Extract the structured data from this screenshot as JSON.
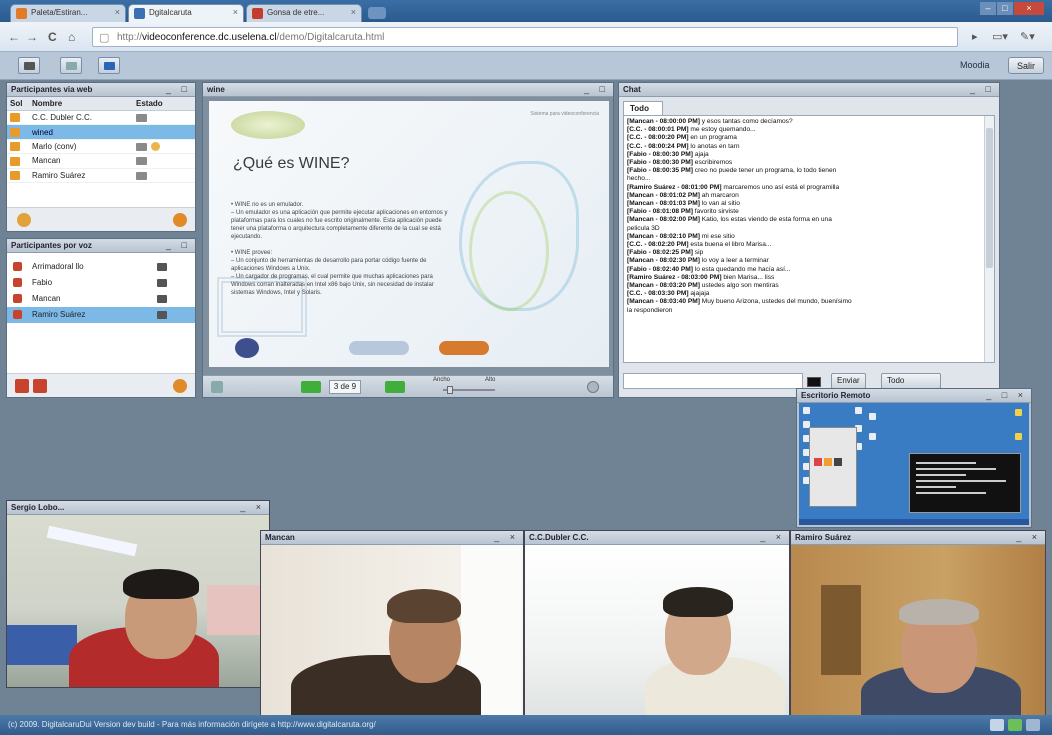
{
  "browser": {
    "tabs": [
      {
        "label": "Paleta/Estiran..."
      },
      {
        "label": "Dgitalcaruta"
      },
      {
        "label": "Gonsa de etre..."
      }
    ],
    "url_prefix": "http://",
    "url_domain": "videoconference.dc.uselena.cl",
    "url_path": "/demo/Digitalcaruta.html"
  },
  "toolbar": {
    "user_label": "Moodia",
    "exit_label": "Salir"
  },
  "participants_web": {
    "title": "Participantes via web",
    "columns": [
      "Sol",
      "Nombre",
      "Estado"
    ],
    "rows": [
      {
        "name": "C.C. Dubler C.C.",
        "cam": true,
        "hand": false,
        "selected": false
      },
      {
        "name": "wined",
        "cam": false,
        "hand": false,
        "selected": true
      },
      {
        "name": "Marlo (conv)",
        "cam": true,
        "hand": true,
        "selected": false
      },
      {
        "name": "Mancan",
        "cam": true,
        "hand": false,
        "selected": false
      },
      {
        "name": "Ramiro Suárez",
        "cam": true,
        "hand": false,
        "selected": false
      }
    ]
  },
  "participants_voice": {
    "title": "Participantes por voz",
    "rows": [
      {
        "name": "Arrimadoral llo",
        "selected": false
      },
      {
        "name": "Fabio",
        "selected": false
      },
      {
        "name": "Mancan",
        "selected": false
      },
      {
        "name": "Ramiro Suárez",
        "selected": true
      }
    ]
  },
  "presentation": {
    "title": "wine",
    "header_small": "Sistema para videoconferencia",
    "slide_title": "¿Qué es WINE?",
    "bullets": [
      "• WINE no es un emulador.",
      "   – Un emulador es una aplicación que permite ejecutar aplicaciones en entornos y",
      "     plataformas para los cuales no fue escrito originalmente. Esta aplicación puede",
      "     tener una plataforma o arquitectura completamente diferente de la cual se está",
      "     ejecutando.",
      "• WINE provee:",
      "   – Un conjunto de herramientas de desarrollo para portar código fuente de",
      "     aplicaciones Windows a Unix.",
      "   – Un cargador de programas, el cual permite que muchas aplicaciones para",
      "     Windows corran inalteradas en Intel x86 bajo Unix, sin necesidad de instalar",
      "     sistemas Windows, Intel y Solaris."
    ],
    "page_value": "3 de 9",
    "zoom_min_label": "Ancho",
    "zoom_max_label": "Alto"
  },
  "chat": {
    "title": "Chat",
    "tab_label": "Todo",
    "messages": [
      {
        "author": "[Mancan - 08:00:00 PM]",
        "text": " y esos tantas como decíamos?"
      },
      {
        "author": "[C.C. - 08:00:01 PM]",
        "text": " me estoy quemando..."
      },
      {
        "author": "[C.C. - 08:00:20 PM]",
        "text": " en un programa"
      },
      {
        "author": "[C.C. - 08:00:24 PM]",
        "text": " lo anotas en tarn"
      },
      {
        "author": "[Fabio - 08:00:30 PM]",
        "text": " ajaja"
      },
      {
        "author": "[Fabio - 08:00:30 PM]",
        "text": " escribiremos"
      },
      {
        "author": "[Fabio - 08:00:35 PM]",
        "text": " creo no puede tener un programa, lo todo tienen"
      },
      {
        "author": "",
        "text": "hecho..."
      },
      {
        "author": "[Ramiro Suárez - 08:01:00 PM]",
        "text": " marcaremos uno así está el programilla"
      },
      {
        "author": "[Mancan - 08:01:02 PM]",
        "text": " ah marcaron"
      },
      {
        "author": "[Mancan - 08:01:03 PM]",
        "text": " lo van al sitio"
      },
      {
        "author": "[Fabio - 08:01:08 PM]",
        "text": " favorito sirviste"
      },
      {
        "author": "[Mancan - 08:02:00 PM]",
        "text": " Katio, los estas viendo de esta forma en una"
      },
      {
        "author": "",
        "text": "pelicula 3D"
      },
      {
        "author": "[Mancan - 08:02:10 PM]",
        "text": " mi ese sitio"
      },
      {
        "author": "[C.C. - 08:02:20 PM]",
        "text": " esta buena el libro Marisa..."
      },
      {
        "author": "[Fabio - 08:02:25 PM]",
        "text": " sip"
      },
      {
        "author": "[Mancan - 08:02:30 PM]",
        "text": " lo voy a leer a terminar"
      },
      {
        "author": "[Fabio - 08:02:40 PM]",
        "text": " lo esta quedando me hacía así..."
      },
      {
        "author": "[Ramiro Suárez - 08:03:00 PM]",
        "text": " bien Marisa... liss"
      },
      {
        "author": "[Mancan - 08:03:20 PM]",
        "text": " ustedes algo son mentiras"
      },
      {
        "author": "[C.C. - 08:03:30 PM]",
        "text": " ajajaja"
      },
      {
        "author": "[Mancan - 08:03:40 PM]",
        "text": " Muy bueno Arizona, ustedes del mundo, buenísimo"
      },
      {
        "author": "",
        "text": "la respondieron"
      }
    ],
    "send_label": "Enviar",
    "target_label": "Todo"
  },
  "remote_desktop": {
    "title": "Escritorio Remoto"
  },
  "videos": [
    {
      "title": "Sergio Lobo..."
    },
    {
      "title": "Mancan"
    },
    {
      "title": "C.C.Dubler C.C."
    },
    {
      "title": "Ramiro Suárez"
    }
  ],
  "status_text": "(c) 2009. DigitalcaruDui Version dev build - Para más información dirígete a http://www.digitalcaruta.org/",
  "colors": {
    "accent": "#7db9e6",
    "chrome": "#2b5a8e",
    "workspace": "#6f8394"
  }
}
